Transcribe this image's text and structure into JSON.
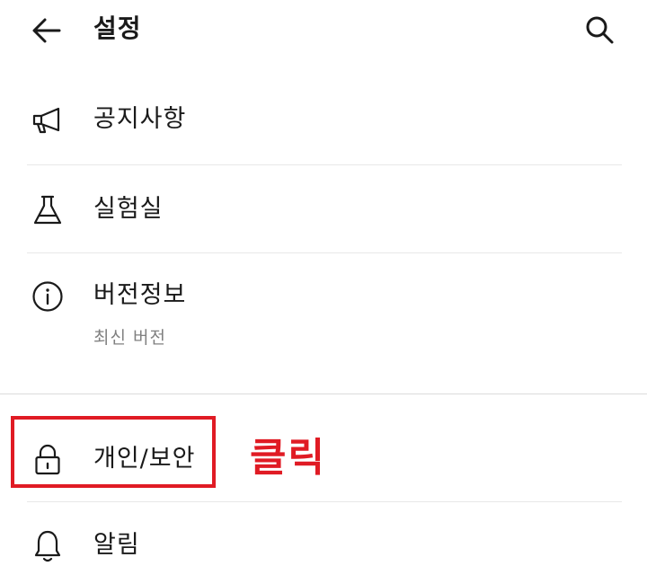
{
  "header": {
    "title": "설정",
    "back_icon": "arrow-left-icon",
    "search_icon": "search-icon"
  },
  "menu": {
    "items": [
      {
        "label": "공지사항",
        "icon": "megaphone-icon"
      },
      {
        "label": "실험실",
        "icon": "flask-icon"
      },
      {
        "label": "버전정보",
        "icon": "info-circle-icon",
        "sublabel": "최신 버전"
      },
      {
        "label": "개인/보안",
        "icon": "lock-icon"
      },
      {
        "label": "알림",
        "icon": "bell-icon"
      }
    ]
  },
  "annotation": {
    "text": "클릭",
    "color": "#e01b24",
    "target": "개인/보안"
  },
  "colors": {
    "text": "#1a1a1a",
    "subtext": "#808080",
    "divider": "#e8e8e8",
    "annotation": "#e01b24"
  }
}
